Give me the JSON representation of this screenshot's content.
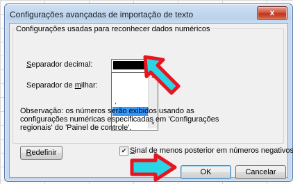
{
  "dialog": {
    "title": "Configurações avançadas de importação de texto",
    "close_glyph": "x"
  },
  "group": {
    "title": "Configurações usadas para reconhecer dados numéricos"
  },
  "decimal_separator": {
    "label_first": "S",
    "label_rest": "eparador decimal:",
    "options": [
      ",",
      "."
    ],
    "selected_index": 1
  },
  "thousands_separator": {
    "label_start": "Separador de ",
    "label_underlined": "m",
    "label_end": "ilhar:"
  },
  "note": "Observação: os números serão exibidos usando as configurações numéricas especificadas em 'Configurações regionais' do 'Painel de controle'.",
  "reset_button": {
    "underlined": "R",
    "rest": "edefinir"
  },
  "trailing_minus": {
    "checked": true,
    "label_underlined": "S",
    "label_rest": "inal de menos posterior em números negativos"
  },
  "ok_button": "OK",
  "cancel_button": "Cancelar",
  "colors": {
    "arrow_fill": "#29d6e8",
    "arrow_outline": "#e8141e",
    "selection": "#3399ff"
  }
}
